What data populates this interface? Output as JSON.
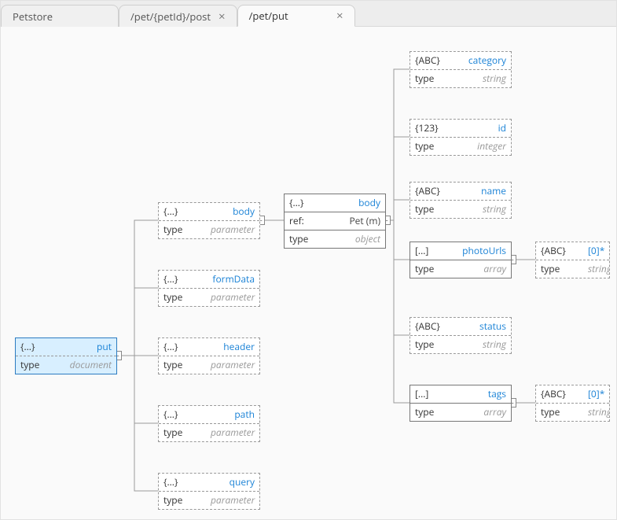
{
  "tabs": [
    {
      "label": "Petstore",
      "closable": false,
      "active": false
    },
    {
      "label": "/pet/{petId}/post",
      "closable": true,
      "active": false
    },
    {
      "label": "/pet/put",
      "closable": true,
      "active": true
    }
  ],
  "glyphs": {
    "obj": "{...}",
    "num": "{123}",
    "str": "{ABC}",
    "arr": "[...]",
    "close": "×",
    "minus": "−"
  },
  "labels": {
    "type": "type",
    "ref": "ref:"
  },
  "nodes": {
    "root": {
      "icon": "obj",
      "title": "put",
      "typeText": "document",
      "style": "selected"
    },
    "p_body": {
      "icon": "obj",
      "title": "body",
      "typeText": "parameter",
      "style": "dashed"
    },
    "p_form": {
      "icon": "obj",
      "title": "formData",
      "typeText": "parameter",
      "style": "dashed"
    },
    "p_header": {
      "icon": "obj",
      "title": "header",
      "typeText": "parameter",
      "style": "dashed"
    },
    "p_path": {
      "icon": "obj",
      "title": "path",
      "typeText": "parameter",
      "style": "dashed"
    },
    "p_query": {
      "icon": "obj",
      "title": "query",
      "typeText": "parameter",
      "style": "dashed"
    },
    "body_ref": {
      "icon": "obj",
      "title": "body",
      "refText": "Pet (m)",
      "typeText": "object",
      "style": "solid"
    },
    "f_cat": {
      "icon": "str",
      "title": "category",
      "typeText": "string",
      "style": "dashed"
    },
    "f_id": {
      "icon": "num",
      "title": "id",
      "typeText": "integer",
      "style": "dashed"
    },
    "f_name": {
      "icon": "str",
      "title": "name",
      "typeText": "string",
      "style": "dashed"
    },
    "f_photo": {
      "icon": "arr",
      "title": "photoUrls",
      "typeText": "array",
      "style": "solid"
    },
    "f_status": {
      "icon": "str",
      "title": "status",
      "typeText": "string",
      "style": "dashed"
    },
    "f_tags": {
      "icon": "arr",
      "title": "tags",
      "typeText": "array",
      "style": "solid"
    },
    "photo_i": {
      "icon": "str",
      "title": "[0]*",
      "typeText": "string",
      "style": "dashed"
    },
    "tags_i": {
      "icon": "str",
      "title": "[0]*",
      "typeText": "string",
      "style": "dashed"
    }
  }
}
